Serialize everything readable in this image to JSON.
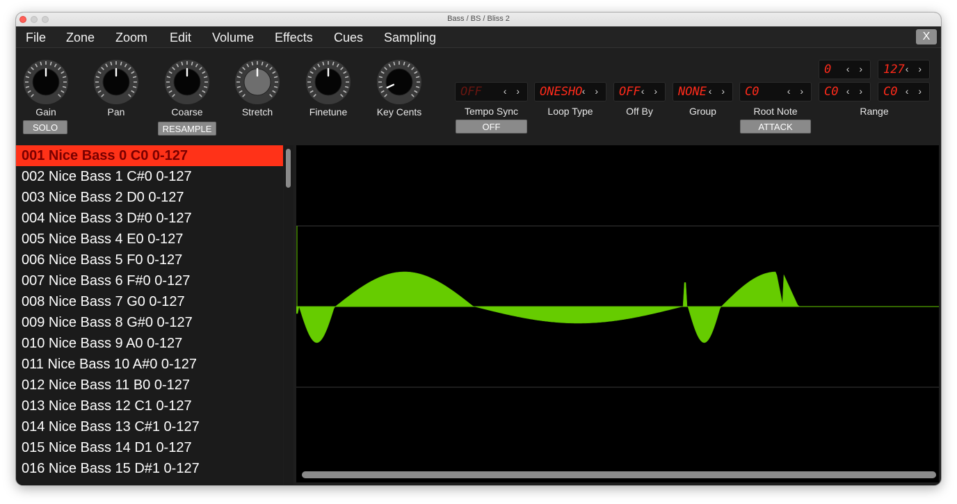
{
  "window": {
    "title": "Bass / BS / Bliss 2"
  },
  "menu": [
    "File",
    "Zone",
    "Zoom",
    "Edit",
    "Volume",
    "Effects",
    "Cues",
    "Sampling"
  ],
  "close_label": "X",
  "knobs": [
    {
      "label": "Gain",
      "button": "SOLO"
    },
    {
      "label": "Pan"
    },
    {
      "label": "Coarse",
      "button": "RESAMPLE"
    },
    {
      "label": "Stretch"
    },
    {
      "label": "Finetune"
    },
    {
      "label": "Key Cents"
    }
  ],
  "params": {
    "tempo_sync": {
      "value": "OFF",
      "label": "Tempo Sync",
      "button": "OFF"
    },
    "loop_type": {
      "value": "ONESHO",
      "label": "Loop Type"
    },
    "off_by": {
      "value": "OFF",
      "label": "Off By"
    },
    "group": {
      "value": "NONE",
      "label": "Group"
    },
    "root_note": {
      "value": "C0",
      "label": "Root Note",
      "button": "ATTACK"
    },
    "range": {
      "vel_low": "0",
      "vel_high": "127",
      "key_low": "C0",
      "key_high": "C0",
      "label": "Range"
    }
  },
  "arrows": "‹ ›",
  "zones": [
    "001 Nice Bass 0 C0 0-127",
    "002 Nice Bass 1 C#0 0-127",
    "003 Nice Bass 2 D0 0-127",
    "004 Nice Bass 3 D#0 0-127",
    "005 Nice Bass 4 E0 0-127",
    "006 Nice Bass 5 F0 0-127",
    "007 Nice Bass 6 F#0 0-127",
    "008 Nice Bass 7 G0 0-127",
    "009 Nice Bass 8 G#0 0-127",
    "010 Nice Bass 9 A0 0-127",
    "011 Nice Bass 10 A#0 0-127",
    "012 Nice Bass 11 B0 0-127",
    "013 Nice Bass 12 C1 0-127",
    "014 Nice Bass 13 C#1 0-127",
    "015 Nice Bass 14 D1 0-127",
    "016 Nice Bass 15 D#1 0-127"
  ],
  "selected_zone": 0,
  "colors": {
    "accent": "#ff3218",
    "waveform": "#66cc00",
    "lcd": "#ff2a1a"
  }
}
